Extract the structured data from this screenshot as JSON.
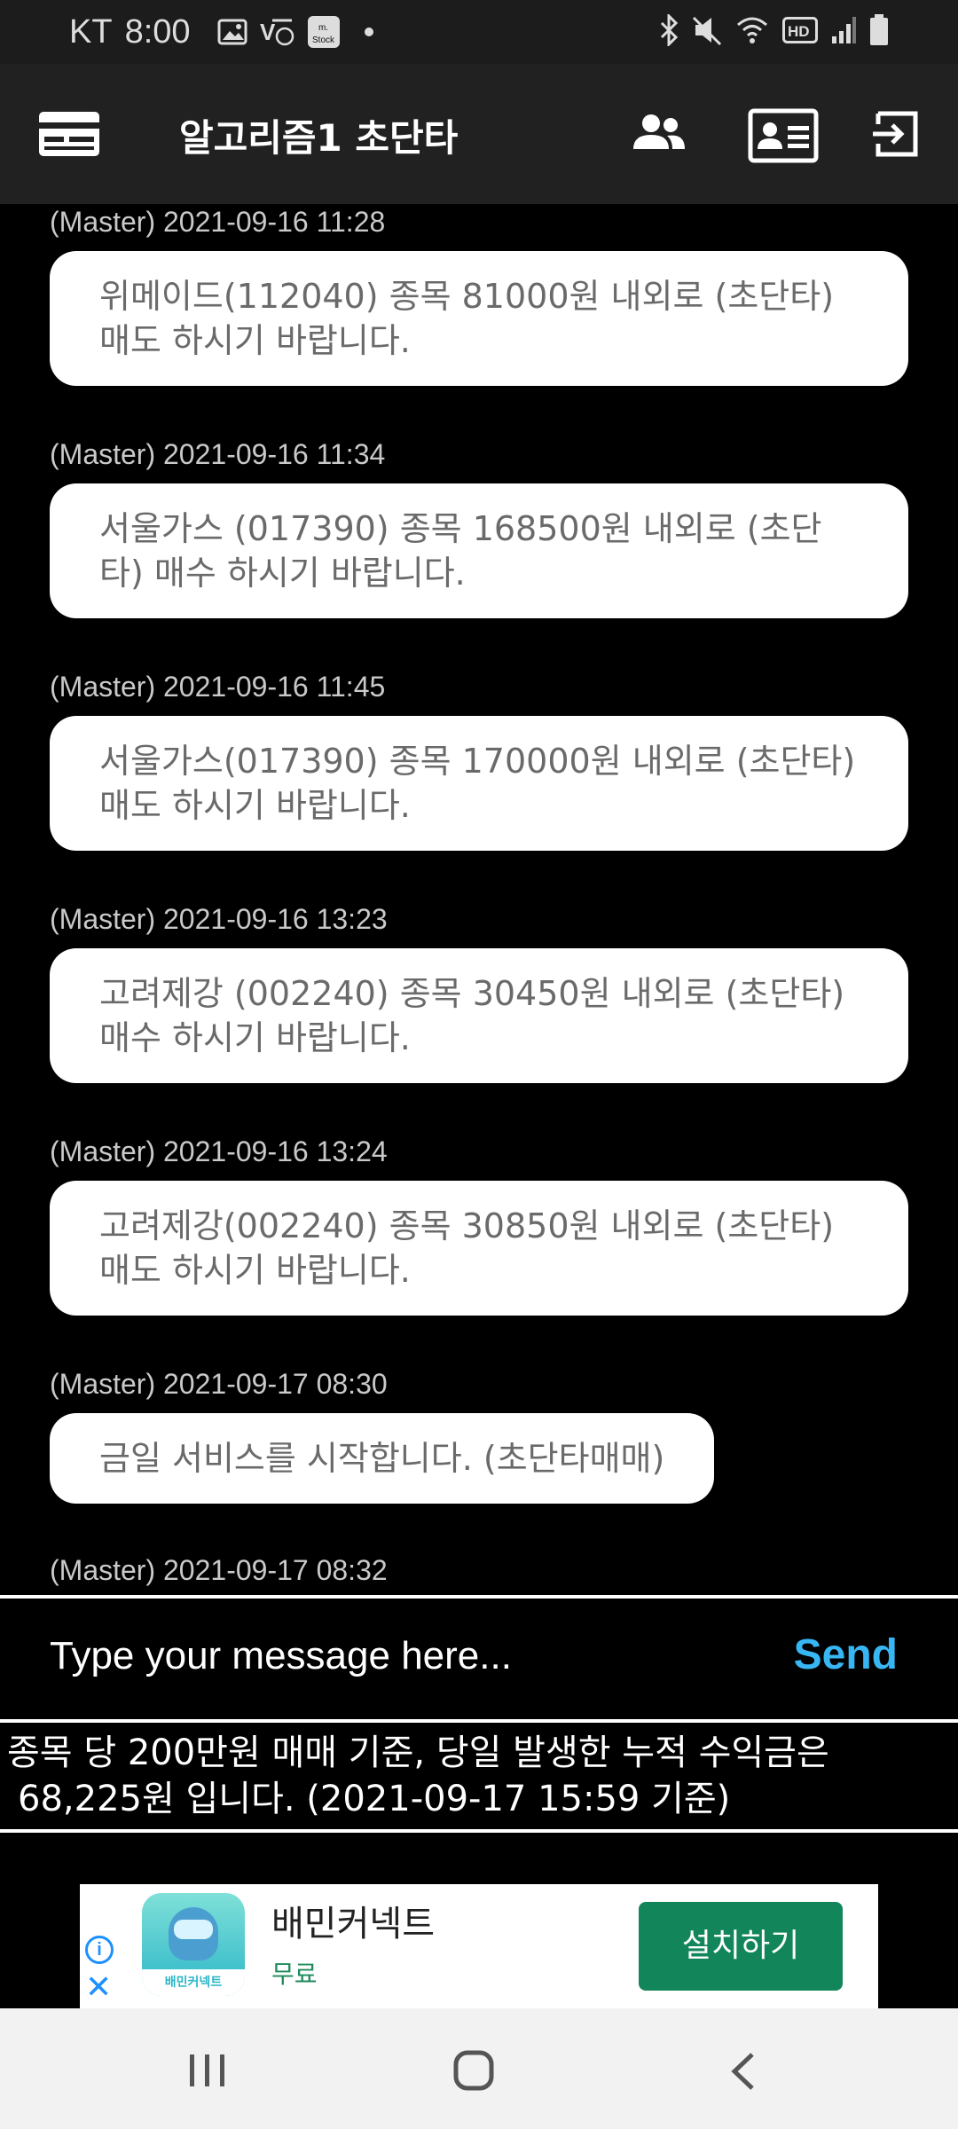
{
  "status_bar": {
    "carrier": "KT",
    "time": "8:00",
    "stock_icon_label": "m.\nStock",
    "icons_left": [
      "image-icon",
      "volte-icon",
      "stock-app-icon",
      "notification-dot-icon"
    ],
    "icons_right": [
      "bluetooth-icon",
      "mute-icon",
      "wifi-icon",
      "hd-icon",
      "signal-icon",
      "battery-icon"
    ],
    "hd_label": "HD"
  },
  "app_bar": {
    "title": "알고리즘1 초단타",
    "icons": [
      "card-menu-icon",
      "users-icon",
      "profile-card-icon",
      "logout-icon"
    ]
  },
  "chat": {
    "messages": [
      {
        "meta": "(Master) 2021-09-16 11:28",
        "text": "위메이드(112040) 종목 81000원 내외로 (초단타) 매도 하시기 바랍니다."
      },
      {
        "meta": "(Master) 2021-09-16 11:34",
        "text": "서울가스 (017390) 종목 168500원 내외로 (초단타) 매수 하시기 바랍니다."
      },
      {
        "meta": "(Master) 2021-09-16 11:45",
        "text": "서울가스(017390) 종목 170000원 내외로 (초단타) 매도 하시기 바랍니다."
      },
      {
        "meta": "(Master) 2021-09-16 13:23",
        "text": "고려제강 (002240) 종목 30450원 내외로 (초단타) 매수 하시기 바랍니다."
      },
      {
        "meta": "(Master) 2021-09-16 13:24",
        "text": "고려제강(002240) 종목 30850원 내외로 (초단타) 매도 하시기 바랍니다."
      },
      {
        "meta": "(Master) 2021-09-17 08:30",
        "text": "금일 서비스를 시작합니다. (초단타매매)"
      },
      {
        "meta": "(Master) 2021-09-17 08:32",
        "text": ""
      }
    ]
  },
  "input": {
    "placeholder": "Type your message here...",
    "value": "",
    "send_label": "Send"
  },
  "summary": {
    "line1": "종목 당 200만원 매매 기준, 당일 발생한 누적 수익금은",
    "line2": "68,225원 입니다. (2021-09-17 15:59 기준)"
  },
  "ad": {
    "app_name": "배민커넥트",
    "price": "무료",
    "install_label": "설치하기",
    "logo_text": "배민커넥트",
    "info_label": "i",
    "close_label": "✕"
  },
  "nav_bar": {
    "icons": [
      "recents-icon",
      "home-icon",
      "back-icon"
    ]
  },
  "colors": {
    "background": "#000000",
    "app_bar": "#212121",
    "status_bar": "#1c1c1c",
    "bubble": "#ffffff",
    "bubble_text": "#6a6a6a",
    "send": "#38b6f4",
    "install": "#12865a"
  }
}
